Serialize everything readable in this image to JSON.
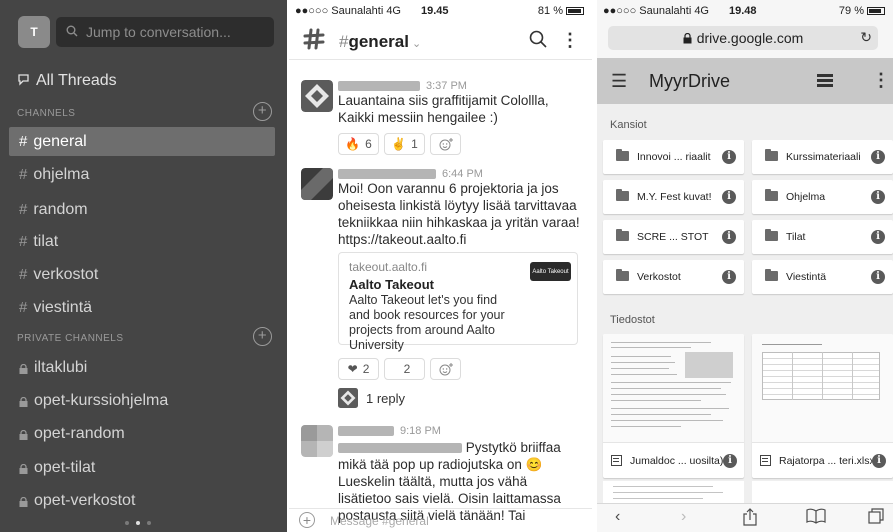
{
  "slack_sidebar": {
    "workspace_initial": "T",
    "jump_placeholder": "Jump to conversation...",
    "all_threads": "All Threads",
    "channels_header": "CHANNELS",
    "channels": [
      "general",
      "ohjelma",
      "random",
      "tilat",
      "verkostot",
      "viestintä"
    ],
    "active_channel": "general",
    "private_header": "PRIVATE CHANNELS",
    "private_channels": [
      "iltaklubi",
      "opet-kurssiohjelma",
      "opet-random",
      "opet-tilat",
      "opet-verkostot"
    ],
    "page_dots": 3,
    "active_dot": 2
  },
  "slack_channel": {
    "status": {
      "carrier": "●●○○○ Saunalahti  4G",
      "time": "19.45",
      "battery": "81 %",
      "battery_level": 0.81
    },
    "channel": {
      "hash": "#",
      "name": "general"
    },
    "messages": [
      {
        "time": "3:37 PM",
        "text": "Lauantaina siis graffitijamit Colollla, Kaikki messiin hengailee :)",
        "reactions": [
          {
            "emoji": "🔥",
            "count": "6"
          },
          {
            "emoji": "✌",
            "count": "1"
          }
        ]
      },
      {
        "time": "6:44 PM",
        "text": "Moi! Oon varannu 6 projektoria ja jos oheisesta linkistä löytyy lisää tarvittavaa tekniikkaa niin hihkaskaa ja yritän varaa! https://takeout.aalto.fi",
        "link_card": {
          "site": "takeout.aalto.fi",
          "title": "Aalto Takeout",
          "description": "Aalto Takeout let's you find and book resources for your projects from around Aalto University",
          "thumb_text": "Aalto Takeout"
        },
        "reactions": [
          {
            "emoji": "❤",
            "count": "2"
          },
          {
            "emoji": "",
            "count": "2"
          }
        ],
        "replies": "1 reply"
      },
      {
        "time": "9:18 PM",
        "text_line1": "Pystytkö briiffaa mikä tää",
        "text_rest": "pop up radiojutska on 😊 Lueskelin täältä, mutta jos vähä lisätietoo sais vielä. Oisin laittamassa postausta siitä vielä tänään! Tai"
      }
    ],
    "compose_placeholder": "Message #general",
    "add_reaction_icon": "emoji-plus"
  },
  "drive": {
    "status": {
      "carrier": "●●○○○ Saunalahti  4G",
      "time": "19.48",
      "battery": "79 %",
      "battery_level": 0.79
    },
    "url": "drive.google.com",
    "title": "MyyrDrive",
    "folders_label": "Kansiot",
    "folders": [
      "Innovoi ... riaalit",
      "Kurssimateriaali",
      "M.Y. Fest kuvat!",
      "Ohjelma",
      "SCRE ... STOT",
      "Tilat",
      "Verkostot",
      "Viestintä"
    ],
    "files_label": "Tiedostot",
    "files": [
      "Jumaldoc ... uosilta)",
      "Rajatorpa ... teri.xlsx"
    ],
    "nav": [
      "‹",
      "›",
      "share",
      "bookmarks",
      "tabs"
    ]
  }
}
